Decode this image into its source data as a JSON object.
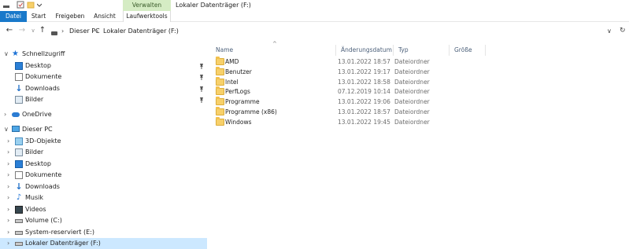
{
  "window": {
    "title": "Lokaler Datenträger (F:)",
    "contextual_tab": "Verwalten"
  },
  "ribbon": {
    "tabs": [
      "Datei",
      "Start",
      "Freigeben",
      "Ansicht",
      "Laufwerktools"
    ],
    "active_tab": "Datei",
    "accent_color": "#1979ca",
    "contextual_color": "#d5ecc4"
  },
  "address": {
    "crumbs": [
      "Dieser PC",
      "Lokaler Datenträger (F:)"
    ]
  },
  "nav": {
    "items": [
      {
        "label": "Schnellzugriff",
        "icon": "star-icon",
        "chevron": "∨",
        "indent": 0,
        "pinned": false
      },
      {
        "label": "Desktop",
        "icon": "desktop-icon",
        "chevron": "",
        "indent": 1,
        "pinned": true
      },
      {
        "label": "Dokumente",
        "icon": "document-icon",
        "chevron": "",
        "indent": 1,
        "pinned": true
      },
      {
        "label": "Downloads",
        "icon": "download-icon",
        "chevron": "",
        "indent": 1,
        "pinned": true
      },
      {
        "label": "Bilder",
        "icon": "pictures-icon",
        "chevron": "",
        "indent": 1,
        "pinned": true
      },
      {
        "label": "OneDrive",
        "icon": "cloud-icon",
        "chevron": "›",
        "indent": 0,
        "pinned": false
      },
      {
        "label": "Dieser PC",
        "icon": "computer-icon",
        "chevron": "∨",
        "indent": 0,
        "pinned": false
      },
      {
        "label": "3D-Objekte",
        "icon": "3d-objects-icon",
        "chevron": "›",
        "indent": 1,
        "pinned": false
      },
      {
        "label": "Bilder",
        "icon": "pictures-icon",
        "chevron": "›",
        "indent": 1,
        "pinned": false
      },
      {
        "label": "Desktop",
        "icon": "desktop-icon",
        "chevron": "›",
        "indent": 1,
        "pinned": false
      },
      {
        "label": "Dokumente",
        "icon": "document-icon",
        "chevron": "›",
        "indent": 1,
        "pinned": false
      },
      {
        "label": "Downloads",
        "icon": "download-icon",
        "chevron": "›",
        "indent": 1,
        "pinned": false
      },
      {
        "label": "Musik",
        "icon": "music-icon",
        "chevron": "›",
        "indent": 1,
        "pinned": false
      },
      {
        "label": "Videos",
        "icon": "video-icon",
        "chevron": "›",
        "indent": 1,
        "pinned": false
      },
      {
        "label": "Volume (C:)",
        "icon": "drive-icon",
        "chevron": "›",
        "indent": 1,
        "pinned": false
      },
      {
        "label": "System-reserviert (E:)",
        "icon": "drive-icon",
        "chevron": "›",
        "indent": 1,
        "pinned": false
      },
      {
        "label": "Lokaler Datenträger (F:)",
        "icon": "drive-icon",
        "chevron": "›",
        "indent": 1,
        "pinned": false,
        "selected": true
      }
    ],
    "selection_color": "#cce8ff"
  },
  "columns": {
    "name": "Name",
    "date": "Änderungsdatum",
    "type": "Typ",
    "size": "Größe"
  },
  "files": [
    {
      "name": "AMD",
      "date": "13.01.2022 18:57",
      "type": "Dateiordner"
    },
    {
      "name": "Benutzer",
      "date": "13.01.2022 19:17",
      "type": "Dateiordner"
    },
    {
      "name": "Intel",
      "date": "13.01.2022 18:58",
      "type": "Dateiordner"
    },
    {
      "name": "PerfLogs",
      "date": "07.12.2019 10:14",
      "type": "Dateiordner"
    },
    {
      "name": "Programme",
      "date": "13.01.2022 19:06",
      "type": "Dateiordner"
    },
    {
      "name": "Programme (x86)",
      "date": "13.01.2022 18:57",
      "type": "Dateiordner"
    },
    {
      "name": "Windows",
      "date": "13.01.2022 19:45",
      "type": "Dateiordner"
    }
  ]
}
